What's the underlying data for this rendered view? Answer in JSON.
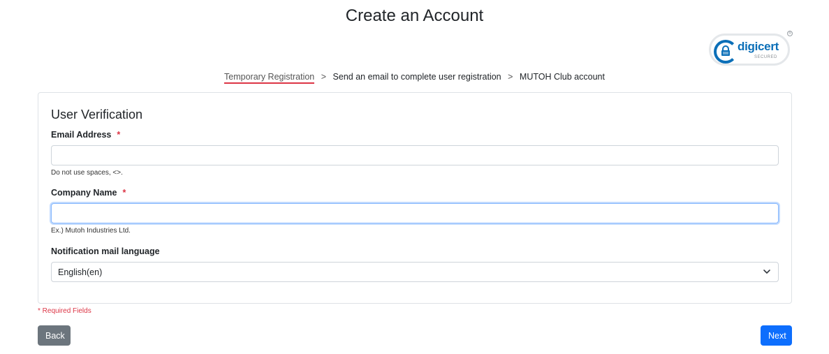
{
  "page": {
    "title": "Create an Account"
  },
  "badge": {
    "name": "digicert",
    "sub": "SECURED",
    "registered": "®"
  },
  "breadcrumb": {
    "steps": [
      "Temporary Registration",
      "Send an email to complete user registration",
      "MUTOH Club account"
    ],
    "separator": ">"
  },
  "form": {
    "title": "User Verification",
    "email": {
      "label": "Email Address",
      "required_mark": "*",
      "value": "",
      "placeholder": "",
      "help": "Do not use spaces, <>."
    },
    "company": {
      "label": "Company Name",
      "required_mark": "*",
      "value": "",
      "placeholder": "",
      "help": "Ex.) Mutoh Industries Ltd."
    },
    "language": {
      "label": "Notification mail language",
      "selected": "English(en)"
    }
  },
  "footer": {
    "required_note": "* Required Fields",
    "back_label": "Back",
    "next_label": "Next"
  },
  "colors": {
    "primary": "#0d6efd",
    "secondary": "#6c757d",
    "danger": "#dc3545",
    "brand": "#0b6fb8"
  }
}
